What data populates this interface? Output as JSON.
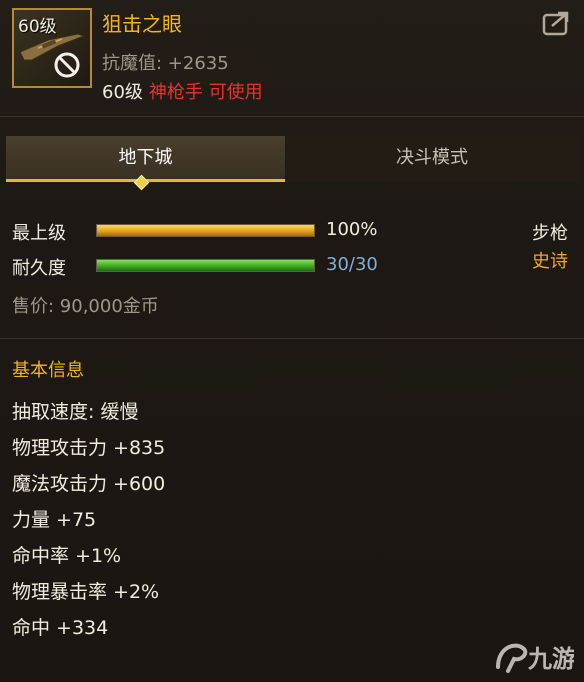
{
  "item": {
    "level_badge": "60级",
    "name": "狙击之眼",
    "resist": "抗魔值: +2635",
    "req_level": "60级",
    "req_class": "神枪手 可使用"
  },
  "tabs": [
    {
      "label": "地下城",
      "active": true
    },
    {
      "label": "决斗模式",
      "active": false
    }
  ],
  "bars": {
    "grade": {
      "label": "最上级",
      "value_text": "100%",
      "fill_fraction": 1.0,
      "color": "#e4a21c"
    },
    "durability": {
      "label": "耐久度",
      "value_text": "30/30",
      "fill_fraction": 1.0,
      "color": "#3cab20"
    }
  },
  "weapon_type": "步枪",
  "rarity": {
    "label": "史诗",
    "color": "#f5a623"
  },
  "price": "售价: 90,000金币",
  "basic_info": {
    "title": "基本信息",
    "stats": [
      "抽取速度: 缓慢",
      "物理攻击力 +835",
      "魔法攻击力 +600",
      "力量 +75",
      "命中率 +1%",
      "物理暴击率 +2%",
      "命中 +334"
    ]
  },
  "watermark": "九游",
  "colors": {
    "name": "#f2b51f",
    "class_req": "#e8332e",
    "durability_value": "#7fb0d8",
    "section": "#f2b51f"
  }
}
